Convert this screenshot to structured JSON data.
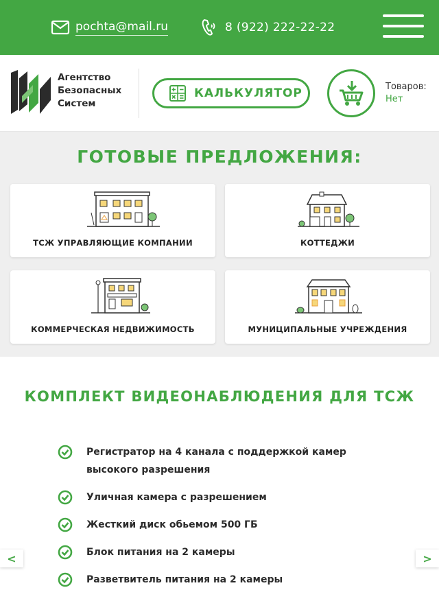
{
  "topbar": {
    "email": "pochta@mail.ru",
    "phone": "8 (922) 222-22-22",
    "mail_icon": "mail-icon",
    "phone_icon": "phone-icon",
    "menu_icon": "hamburger-menu-icon",
    "bg_color": "#43a743"
  },
  "header": {
    "logo_text": "Агентство\nБезопасных\nСистем",
    "calculator_label": "КАЛЬКУЛЯТОР",
    "calculator_icon": "calculator-icon",
    "cart_icon": "cart-icon",
    "cart_label": "Товаров:",
    "cart_value": "Нет"
  },
  "offers": {
    "title": "ГОТОВЫЕ ПРЕДЛОЖЕНИЯ:",
    "cards": [
      {
        "label": "ТСЖ УПРАВЛЯЮЩИЕ КОМПАНИИ",
        "icon": "apartment-building-icon"
      },
      {
        "label": "КОТТЕДЖИ",
        "icon": "cottage-icon"
      },
      {
        "label": "КОММЕРЧЕСКАЯ НЕДВИЖИМОСТЬ",
        "icon": "commercial-building-icon"
      },
      {
        "label": "МУНИЦИПАЛЬНЫЕ УЧРЕЖДЕНИЯ",
        "icon": "municipal-building-icon"
      }
    ]
  },
  "kit": {
    "title": "КОМПЛЕКТ ВИДЕОНАБЛЮДЕНИЯ ДЛЯ ТСЖ",
    "items": [
      "Регистратор на 4 канала с поддержкой камер высокого разрешения",
      "Уличная камера с разрешением",
      "Жесткий диск обьемом 500 ГБ",
      "Блок питания на 2 камеры",
      "Разветвитель питания на 2 камеры"
    ]
  },
  "nav": {
    "prev": "<",
    "next": ">"
  },
  "colors": {
    "accent": "#43a743",
    "section_bg": "#efefef"
  }
}
